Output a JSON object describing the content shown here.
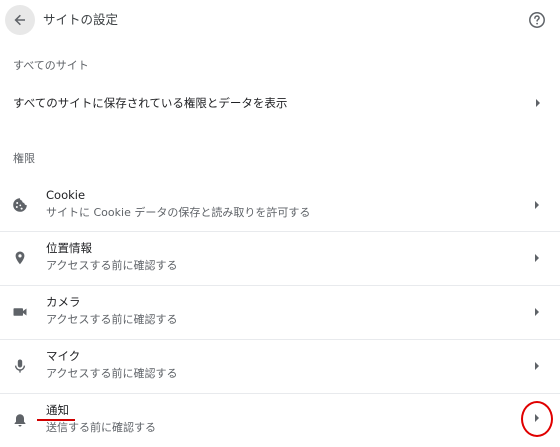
{
  "header": {
    "title": "サイトの設定",
    "back_icon": "arrow-left-icon",
    "help_icon": "help-circle-icon"
  },
  "all_sites": {
    "section_label": "すべてのサイト",
    "row_label": "すべてのサイトに保存されている権限とデータを表示"
  },
  "permissions": {
    "section_label": "権限",
    "items": [
      {
        "title": "Cookie",
        "subtitle": "サイトに Cookie データの保存と読み取りを許可する",
        "icon": "cookie-icon"
      },
      {
        "title": "位置情報",
        "subtitle": "アクセスする前に確認する",
        "icon": "location-pin-icon"
      },
      {
        "title": "カメラ",
        "subtitle": "アクセスする前に確認する",
        "icon": "camera-icon"
      },
      {
        "title": "マイク",
        "subtitle": "アクセスする前に確認する",
        "icon": "microphone-icon"
      },
      {
        "title": "通知",
        "subtitle": "送信する前に確認する",
        "icon": "bell-icon"
      }
    ]
  },
  "colors": {
    "annotation_red": "#e00000",
    "icon_gray": "#5f6368"
  }
}
